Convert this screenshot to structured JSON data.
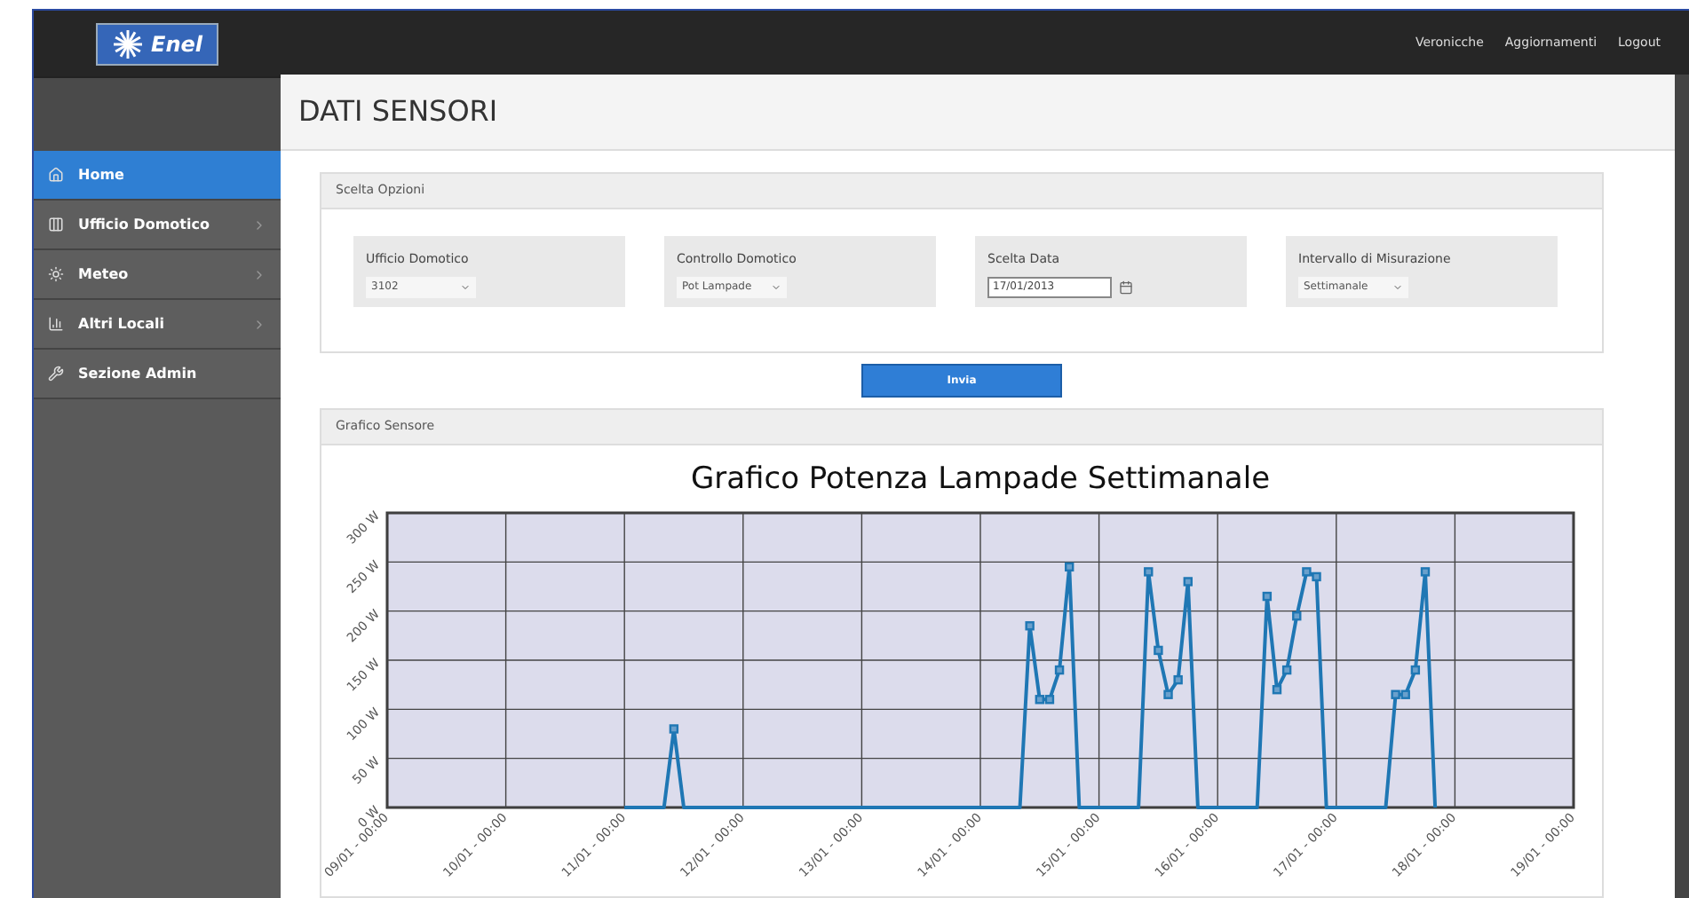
{
  "logo": {
    "text": "Enel"
  },
  "topbar": {
    "links": [
      "Veronicche",
      "Aggiornamenti",
      "Logout"
    ]
  },
  "sidebar": {
    "items": [
      {
        "label": "Home",
        "selected": true,
        "has_submenu": false
      },
      {
        "label": "Ufficio Domotico",
        "selected": false,
        "has_submenu": true
      },
      {
        "label": "Meteo",
        "selected": false,
        "has_submenu": true
      },
      {
        "label": "Altri Locali",
        "selected": false,
        "has_submenu": true
      },
      {
        "label": "Sezione Admin",
        "selected": false,
        "has_submenu": false
      }
    ]
  },
  "page_title": "DATI SENSORI",
  "options_panel": {
    "title": "Scelta Opzioni",
    "fields": [
      {
        "kind": "select",
        "label": "Ufficio Domotico",
        "value": "3102"
      },
      {
        "kind": "select",
        "label": "Controllo Domotico",
        "value": "Pot Lampade"
      },
      {
        "kind": "date",
        "label": "Scelta Data",
        "value": "17/01/2013"
      },
      {
        "kind": "select",
        "label": "Intervallo di Misurazione",
        "value": "Settimanale"
      }
    ]
  },
  "submit_button": "Invia",
  "chart_panel": {
    "title": "Grafico Sensore",
    "chart_data": {
      "type": "line",
      "title": "Grafico Potenza Lampade Settimanale",
      "categories": [
        "09/01 - 00:00",
        null,
        null,
        null,
        null,
        null,
        null,
        null,
        null,
        null,
        null,
        null,
        "10/01 - 00:00",
        null,
        null,
        null,
        null,
        null,
        null,
        null,
        null,
        null,
        null,
        null,
        "11/01 - 00:00",
        null,
        null,
        null,
        null,
        null,
        null,
        null,
        null,
        null,
        null,
        null,
        "12/01 - 00:00",
        null,
        null,
        null,
        null,
        null,
        null,
        null,
        null,
        null,
        null,
        null,
        "13/01 - 00:00",
        null,
        null,
        null,
        null,
        null,
        null,
        null,
        null,
        null,
        null,
        null,
        "14/01 - 00:00",
        null,
        null,
        null,
        null,
        null,
        null,
        null,
        null,
        null,
        null,
        null,
        "15/01 - 00:00",
        null,
        null,
        null,
        null,
        null,
        null,
        null,
        null,
        null,
        null,
        null,
        "16/01 - 00:00",
        null,
        null,
        null,
        null,
        null,
        null,
        null,
        null,
        null,
        null,
        null,
        "17/01 - 00:00",
        null,
        null,
        null,
        null,
        null,
        null,
        null,
        null,
        null,
        null,
        null,
        "18/01 - 00:00",
        null,
        null,
        null,
        null,
        null,
        null,
        null,
        null,
        null,
        null,
        null,
        "19/01 - 00:00"
      ],
      "series": [
        {
          "color": "#1f77b4",
          "values": [
            null,
            null,
            null,
            null,
            null,
            null,
            null,
            null,
            null,
            null,
            null,
            null,
            null,
            null,
            null,
            null,
            null,
            null,
            null,
            null,
            null,
            null,
            null,
            null,
            0,
            0,
            0,
            0,
            0,
            80,
            0,
            0,
            0,
            0,
            0,
            0,
            0,
            0,
            0,
            0,
            0,
            0,
            0,
            0,
            0,
            0,
            0,
            0,
            0,
            0,
            0,
            0,
            0,
            0,
            0,
            0,
            0,
            0,
            0,
            0,
            0,
            0,
            0,
            0,
            0,
            185,
            110,
            110,
            140,
            245,
            0,
            0,
            0,
            0,
            0,
            0,
            0,
            240,
            160,
            115,
            130,
            230,
            0,
            0,
            0,
            0,
            0,
            0,
            0,
            215,
            120,
            140,
            195,
            240,
            235,
            0,
            0,
            0,
            0,
            0,
            0,
            0,
            115,
            115,
            140,
            240,
            0,
            null,
            null,
            null,
            null,
            null,
            null,
            null,
            null,
            null,
            null,
            null,
            null,
            null,
            null
          ]
        }
      ],
      "ylim": [
        0,
        300
      ],
      "grid": true,
      "yticks": [
        {
          "value": 0,
          "label": "0 W"
        },
        {
          "value": 50,
          "label": "50 W"
        },
        {
          "value": 100,
          "label": "100 W"
        },
        {
          "value": 150,
          "label": "150 W"
        },
        {
          "value": 200,
          "label": "200 W"
        },
        {
          "value": 250,
          "label": "250 W"
        },
        {
          "value": 300,
          "label": "300 W"
        }
      ]
    }
  }
}
